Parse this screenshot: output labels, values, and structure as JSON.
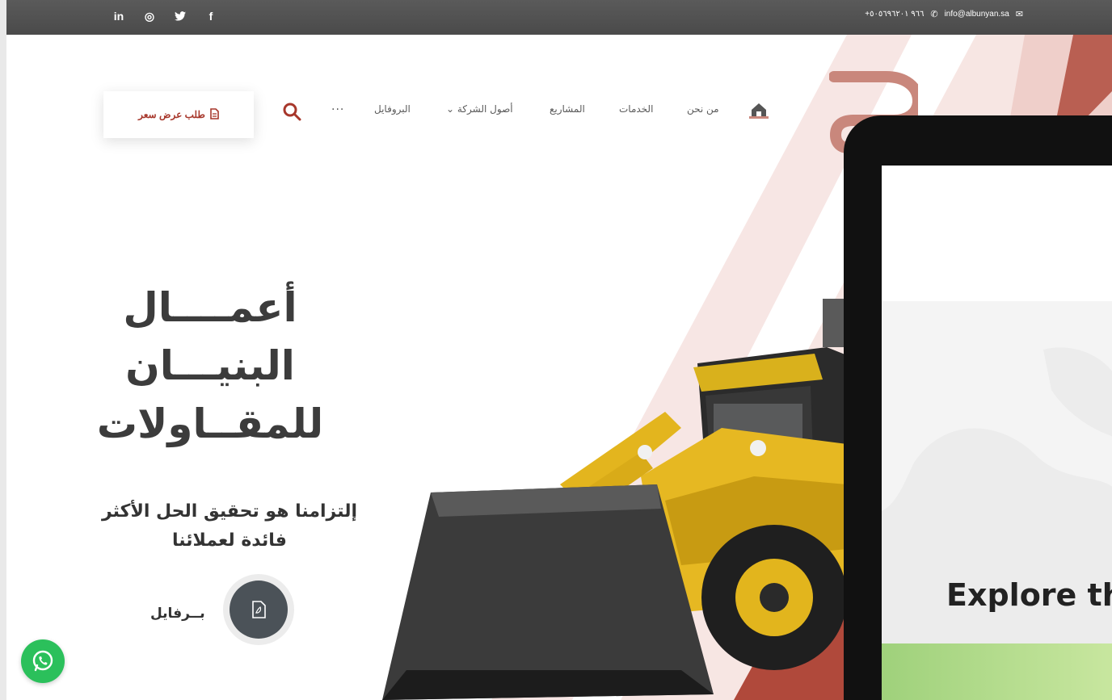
{
  "topbar": {
    "social": [
      "in",
      "◎",
      "🐦",
      "f"
    ],
    "phone": "+٩٦٦ ٥٠٥٦٩٦٢٠١",
    "email": "info@albunyan.sa"
  },
  "nav": {
    "items": [
      {
        "label": "من نحن"
      },
      {
        "label": "الخدمات"
      },
      {
        "label": "المشاريع"
      },
      {
        "label": "أصول الشركة ⌄"
      },
      {
        "label": "البروفايل"
      }
    ],
    "more": "···",
    "quote_button": "طلب عرض سعر"
  },
  "hero": {
    "title_lines": [
      "أعمــــال",
      "البنيـــان",
      "للمقــاولات"
    ],
    "subtitle_lines": [
      "إلتزامنا هو تحقيق الحل الأكثر",
      "فائدة لعملائنا"
    ],
    "profile_label": "بــرفايل"
  },
  "tablet": {
    "heading": "Explore th"
  },
  "colors": {
    "brand": "#a7372b",
    "accent_light": "#f2d9d6",
    "whatsapp": "#2bc05b"
  }
}
